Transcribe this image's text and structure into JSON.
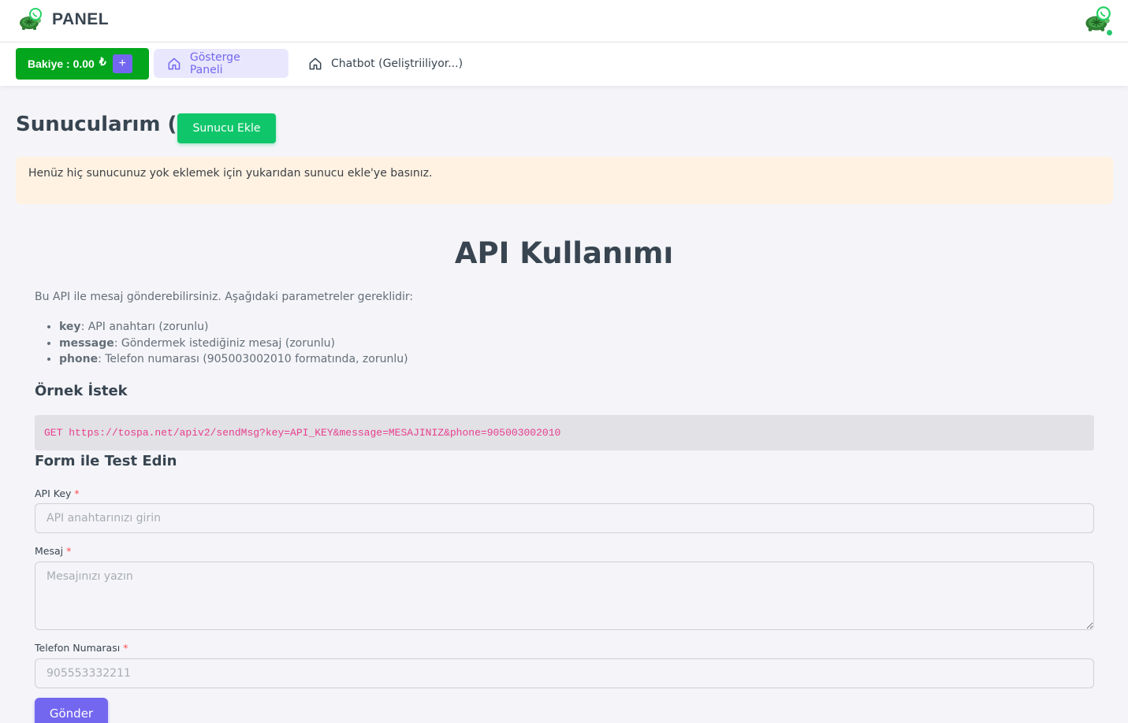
{
  "header": {
    "brand": "PANEL",
    "logo_icon": "turtle-whatsapp-logo",
    "avatar_icon": "turtle-whatsapp-avatar"
  },
  "nav": {
    "balance_label": "Bakiye : 0.00",
    "currency_symbol": "₺",
    "add_balance_label": "+",
    "items": [
      {
        "label": "Gösterge Paneli",
        "icon": "home-icon",
        "active": true
      },
      {
        "label": "Chatbot (Geliştriiliyor...)",
        "icon": "home-icon",
        "active": false
      }
    ]
  },
  "servers": {
    "title": "Sunucularım (0)",
    "add_button": "Sunucu Ekle",
    "empty_alert": "Henüz hiç sunucunuz yok eklemek için yukarıdan sunucu ekle'ye basınız."
  },
  "api": {
    "title": "API Kullanımı",
    "description": "Bu API ile mesaj gönderebilirsiniz. Aşağıdaki parametreler gereklidir:",
    "params": [
      {
        "name": "key",
        "desc": ": API anahtarı (zorunlu)"
      },
      {
        "name": "message",
        "desc": ": Göndermek istediğiniz mesaj (zorunlu)"
      },
      {
        "name": "phone",
        "desc": ": Telefon numarası (905003002010 formatında, zorunlu)"
      }
    ],
    "example_heading": "Örnek İstek",
    "example_request": "GET https://tospa.net/apiv2/sendMsg?key=API_KEY&message=MESAJINIZ&phone=905003002010",
    "form_heading": "Form ile Test Edin",
    "required_mark": "*",
    "fields": {
      "api_key": {
        "label": "API Key",
        "placeholder": "API anahtarınızı girin"
      },
      "message": {
        "label": "Mesaj",
        "placeholder": "Mesajınızı yazın"
      },
      "phone": {
        "label": "Telefon Numarası",
        "placeholder": "905553332211"
      }
    },
    "submit_label": "Gönder"
  },
  "colors": {
    "primary": "#7367f0",
    "success": "#03a61d",
    "add_button": "#10c66b",
    "alert_bg": "#fff2e2",
    "code_text": "#e83e8c"
  }
}
